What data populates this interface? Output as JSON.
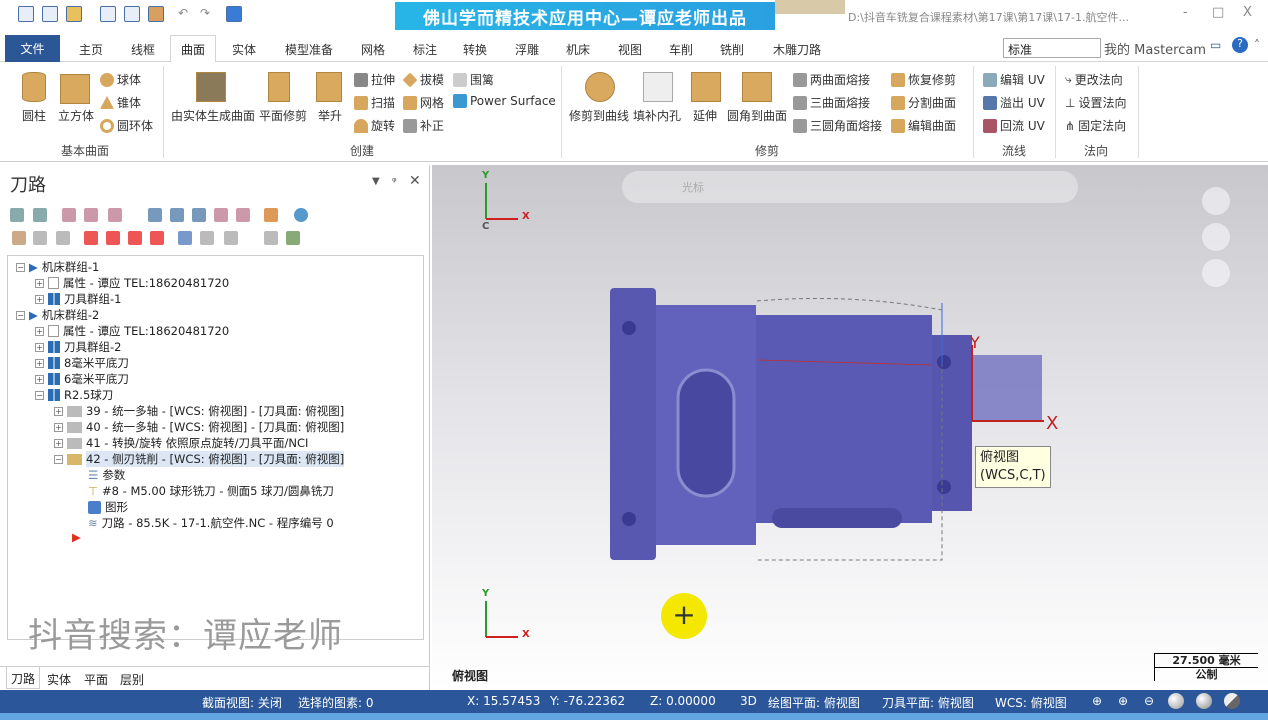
{
  "titlebar": {
    "banner": "佛山学而精技术应用中心—谭应老师出品",
    "path": "D:\\抖音车铣复合课程素材\\第17课\\第17课\\17-1.航空件...",
    "min": "‐",
    "max": "□",
    "close": "X"
  },
  "tabs": {
    "file": "文件",
    "items": [
      "主页",
      "线框",
      "曲面",
      "实体",
      "模型准备",
      "网格",
      "标注",
      "转换",
      "浮雕",
      "机床",
      "视图",
      "车削",
      "铣削",
      "木雕刀路"
    ],
    "style_value": "标准",
    "my_mastercam": "我的 Mastercam"
  },
  "ribbon": {
    "basic": {
      "label": "基本曲面",
      "cylinder": "圆柱",
      "cube": "立方体",
      "sphere": "球体",
      "cone": "锥体",
      "torus": "圆环体"
    },
    "create": {
      "label": "创建",
      "from_solid": "由实体生成曲面",
      "flat": "平面修剪",
      "loft": "举升",
      "extrude": "拉伸",
      "sweep": "扫描",
      "revolve": "旋转",
      "draft": "拔模",
      "net": "网格",
      "offset": "补正",
      "fence": "围篱",
      "power": "Power Surface"
    },
    "trim": {
      "label": "修剪",
      "trim_curve": "修剪到曲线",
      "fill": "填补内孔",
      "extend": "延伸",
      "fillet": "圆角到曲面",
      "b2": "两曲面熔接",
      "b3": "三曲面熔接",
      "b3f": "三圆角面熔接",
      "untrim": "恢复修剪",
      "split": "分割曲面",
      "edit": "编辑曲面"
    },
    "flow": {
      "label": "流线",
      "edit_uv": "编辑 UV",
      "over_uv": "溢出 UV",
      "flow_uv": "回流 UV"
    },
    "normal": {
      "label": "法向",
      "change": "更改法向",
      "set": "设置法向",
      "fix": "固定法向"
    }
  },
  "panel": {
    "title": "刀路",
    "watermark": "抖音搜索：谭应老师",
    "bottom_tabs": [
      "刀路",
      "实体",
      "平面",
      "层别"
    ]
  },
  "tree": [
    "机床群组-1",
    "属性 - 谭应 TEL:18620481720",
    "刀具群组-1",
    "机床群组-2",
    "属性 - 谭应 TEL:18620481720",
    "刀具群组-2",
    "8毫米平底刀",
    "6毫米平底刀",
    "R2.5球刀",
    "39 - 统一多轴 - [WCS: 俯视图] - [刀具面: 俯视图]",
    "40 - 统一多轴 - [WCS: 俯视图] - [刀具面: 俯视图]",
    "41 - 转换/旋转 依照原点旋转/刀具平面/NCI",
    "42 - 侧刃铣削 - [WCS: 俯视图] - [刀具面: 俯视图]",
    "参数",
    "#8 - M5.00 球形铣刀 - 侧面5 球刀/圆鼻铣刀",
    "图形",
    "刀路 - 85.5K - 17-1.航空件.NC - 程序编号 0"
  ],
  "viewport": {
    "view_name": "俯视图",
    "tooltip_line1": "俯视图",
    "tooltip_line2": "(WCS,C,T)",
    "axis_x": "X",
    "axis_y": "Y",
    "axis_c": "C",
    "scale": "27.500 毫米",
    "scale_unit": "公制",
    "toolbar_label": "光标"
  },
  "status": {
    "section": "截面视图: 关闭",
    "selected": "选择的图素: 0",
    "x": "X:   15.57453",
    "y": "Y:   -76.22362",
    "z": "Z:   0.00000",
    "mode": "3D",
    "cplane": "绘图平面: 俯视图",
    "tplane": "刀具平面: 俯视图",
    "wcs": "WCS: 俯视图"
  },
  "colors": {
    "accent": "#2b579a",
    "part": "#5a5ab4"
  }
}
